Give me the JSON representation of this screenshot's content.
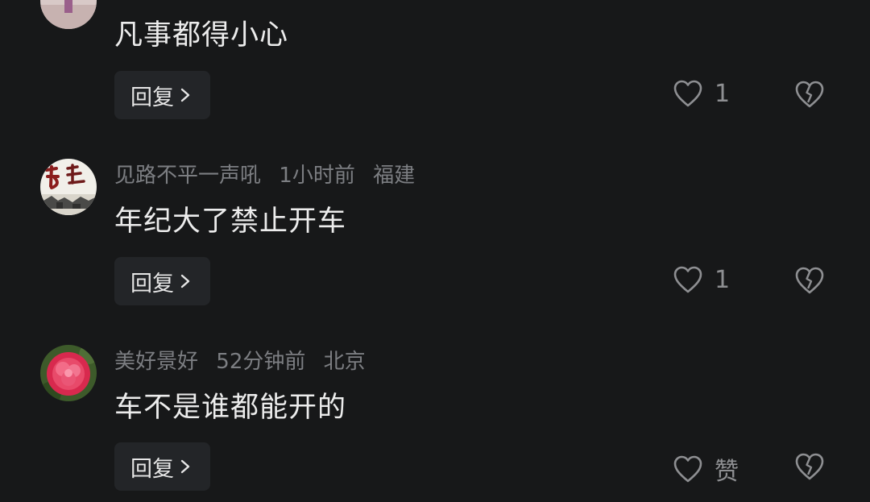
{
  "colors": {
    "background": "#171819",
    "meta_text": "#7c7e82",
    "reply_bg": "#232528",
    "icon": "#8e8f92"
  },
  "comments": [
    {
      "avatar_icon": "user-avatar-photo-icon",
      "username": "",
      "time": "",
      "location": "",
      "text": "凡事都得小心",
      "reply_label": "回复",
      "like_value": "1"
    },
    {
      "avatar_icon": "calligraphy-avatar-icon",
      "username": "见路不平一声吼",
      "time": "1小时前",
      "location": "福建",
      "text": "年纪大了禁止开车",
      "reply_label": "回复",
      "like_value": "1"
    },
    {
      "avatar_icon": "peony-flower-avatar-icon",
      "username": "美好景好",
      "time": "52分钟前",
      "location": "北京",
      "text": "车不是谁都能开的",
      "reply_label": "回复",
      "like_value": "赞"
    }
  ]
}
